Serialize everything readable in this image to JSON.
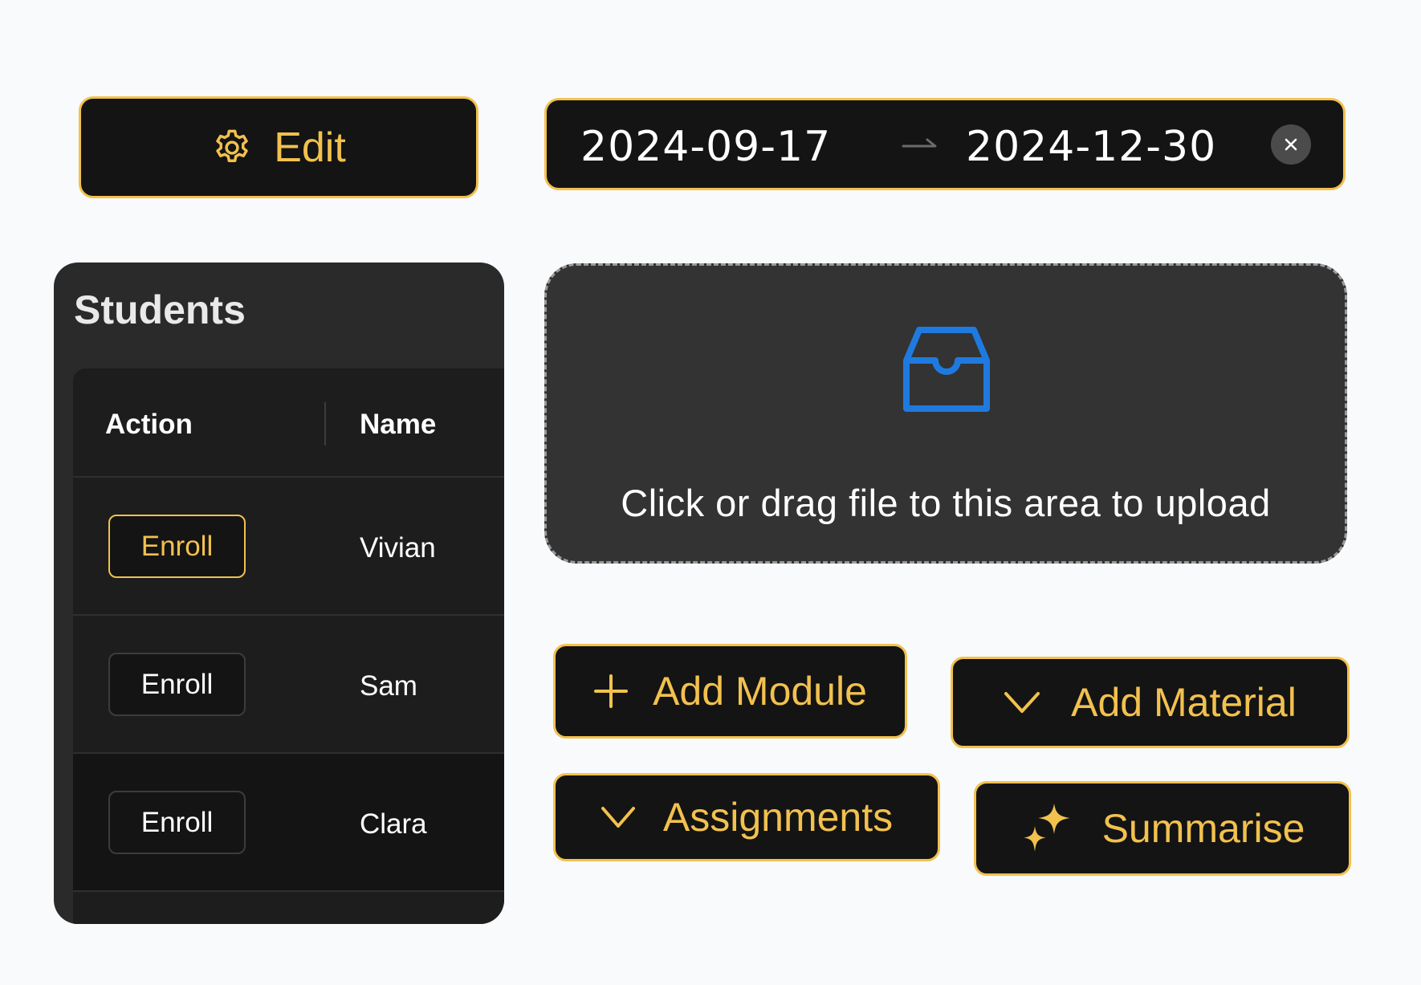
{
  "colors": {
    "accent": "#f2c14e",
    "page_bg": "#f9fafc",
    "surface": "#141414",
    "card": "#2a2a2a",
    "upload_icon": "#1f7ae0"
  },
  "edit_button": {
    "label": "Edit",
    "icon": "gear-icon"
  },
  "date_range": {
    "start": "2024-09-17",
    "end": "2024-12-30",
    "separator_icon": "arrow-right-icon",
    "clear_icon": "close-circle-icon"
  },
  "students": {
    "title": "Students",
    "columns": [
      "Action",
      "Name"
    ],
    "rows": [
      {
        "action": "Enroll",
        "name": "Vivian"
      },
      {
        "action": "Enroll",
        "name": "Sam"
      },
      {
        "action": "Enroll",
        "name": "Clara"
      }
    ]
  },
  "upload": {
    "text": "Click or drag file to this area to upload",
    "icon": "inbox-icon"
  },
  "buttons": {
    "add_module": {
      "label": "Add Module",
      "icon": "plus-icon"
    },
    "add_material": {
      "label": "Add Material",
      "icon": "chevron-down-icon"
    },
    "assignments": {
      "label": "Assignments",
      "icon": "chevron-down-icon"
    },
    "summarise": {
      "label": "Summarise",
      "icon": "sparkle-icon"
    }
  }
}
